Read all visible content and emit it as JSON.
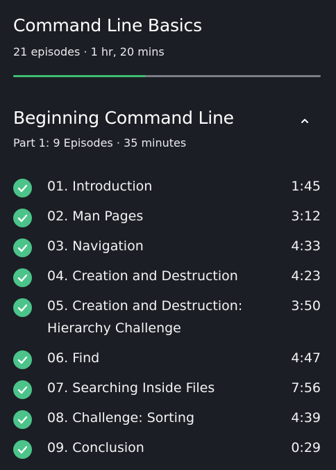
{
  "course": {
    "title": "Command Line Basics",
    "meta": "21 episodes · 1 hr, 20 mins",
    "progress_fraction": 0.43,
    "accent_color": "#3fbf73"
  },
  "section": {
    "title": "Beginning Command Line",
    "meta": "Part 1: 9 Episodes · 35 minutes",
    "toggle_icon": "chevron-up-icon"
  },
  "episodes": [
    {
      "title": "01. Introduction",
      "duration": "1:45",
      "completed": true
    },
    {
      "title": "02. Man Pages",
      "duration": "3:12",
      "completed": true
    },
    {
      "title": "03. Navigation",
      "duration": "4:33",
      "completed": true
    },
    {
      "title": "04. Creation and Destruction",
      "duration": "4:23",
      "completed": true
    },
    {
      "title": "05. Creation and Destruction: Hierarchy Challenge",
      "duration": "3:50",
      "completed": true
    },
    {
      "title": "06. Find",
      "duration": "4:47",
      "completed": true
    },
    {
      "title": "07. Searching Inside Files",
      "duration": "7:56",
      "completed": true
    },
    {
      "title": "08. Challenge: Sorting",
      "duration": "4:39",
      "completed": true
    },
    {
      "title": "09. Conclusion",
      "duration": "0:29",
      "completed": true
    }
  ]
}
